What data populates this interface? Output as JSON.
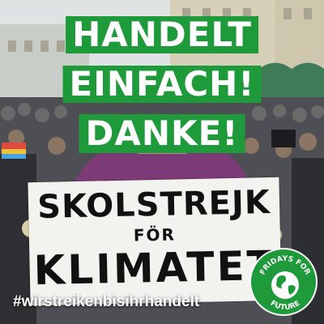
{
  "headline": [
    "HANDELT",
    "EINFACH!",
    "DANKE!"
  ],
  "sign": {
    "line1": "SKOLSTREJK",
    "line2": "FÖR",
    "line3": "KLIMATET"
  },
  "hashtag": "#wirstreikenbisihrhandelt",
  "badge": {
    "top_text": "FRIDAYS FOR",
    "bottom_text": "FUTURE",
    "icon": "earth-globe-icon"
  },
  "colors": {
    "accent_green": "#1f9a3a",
    "text_white": "#ffffff",
    "sign_background": "#f2f2ef"
  }
}
